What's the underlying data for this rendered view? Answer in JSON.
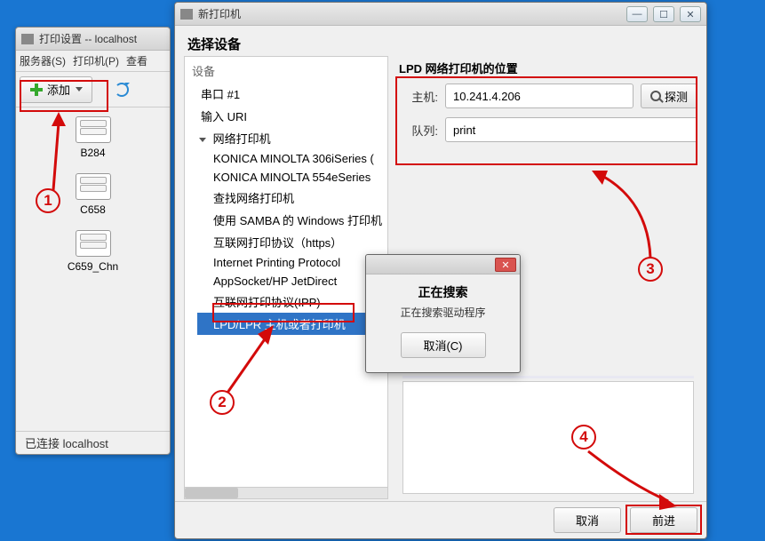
{
  "print_window": {
    "title": "打印设置 -- localhost",
    "menu": {
      "server": "服务器(S)",
      "printer": "打印机(P)",
      "view": "查看"
    },
    "add_label": "添加",
    "printers": [
      {
        "name": "B284"
      },
      {
        "name": "C658"
      },
      {
        "name": "C659_Chn"
      }
    ],
    "status": "已连接 localhost"
  },
  "new_window": {
    "title": "新打印机",
    "section": "选择设备",
    "devices_header": "设备",
    "tree": {
      "serial": "串口 #1",
      "uri": "输入 URI",
      "network": "网络打印机",
      "children": [
        "KONICA MINOLTA 306iSeries (",
        "KONICA MINOLTA 554eSeries",
        "查找网络打印机",
        "使用 SAMBA 的 Windows 打印机",
        "互联网打印协议（https）",
        "Internet Printing Protocol",
        "AppSocket/HP JetDirect",
        "互联网打印协议(IPP)",
        "LPD/LPR 主机或者打印机"
      ]
    },
    "form": {
      "group": "LPD 网络打印机的位置",
      "host_label": "主机:",
      "host_value": "10.241.4.206",
      "queue_label": "队列:",
      "queue_value": "print",
      "probe": "探测"
    },
    "footer": {
      "cancel": "取消",
      "forward": "前进"
    }
  },
  "dialog": {
    "title": "正在搜索",
    "text": "正在搜索驱动程序",
    "cancel": "取消(C)"
  }
}
